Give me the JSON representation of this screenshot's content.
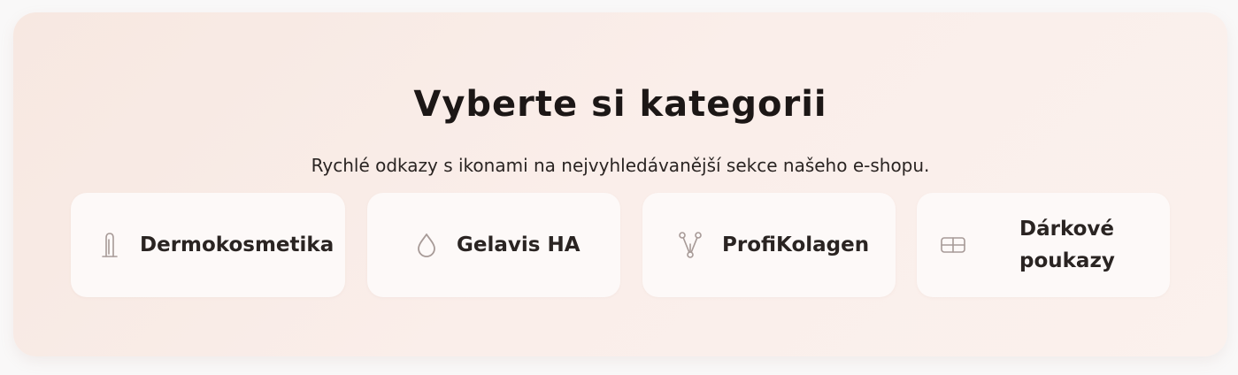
{
  "section": {
    "title": "Vyberte si kategorii",
    "subtitle": "Rychlé odkazy s ikonami na nejvyhledávanější sekce našeho e-shopu."
  },
  "categories": [
    {
      "label": "Dermokosmetika",
      "icon": "bottle-icon"
    },
    {
      "label": "Gelavis HA",
      "icon": "drop-icon"
    },
    {
      "label": "ProfiKolagen",
      "icon": "molecule-icon"
    },
    {
      "label_line1": "Dárkové",
      "label_line2": "poukazy",
      "icon": "gift-card-icon"
    }
  ],
  "colors": {
    "background_start": "#f7e8e1",
    "background_end": "#fbf1ed",
    "card": "#fdf9f8",
    "text": "#2a2422",
    "icon": "#a79a97"
  }
}
